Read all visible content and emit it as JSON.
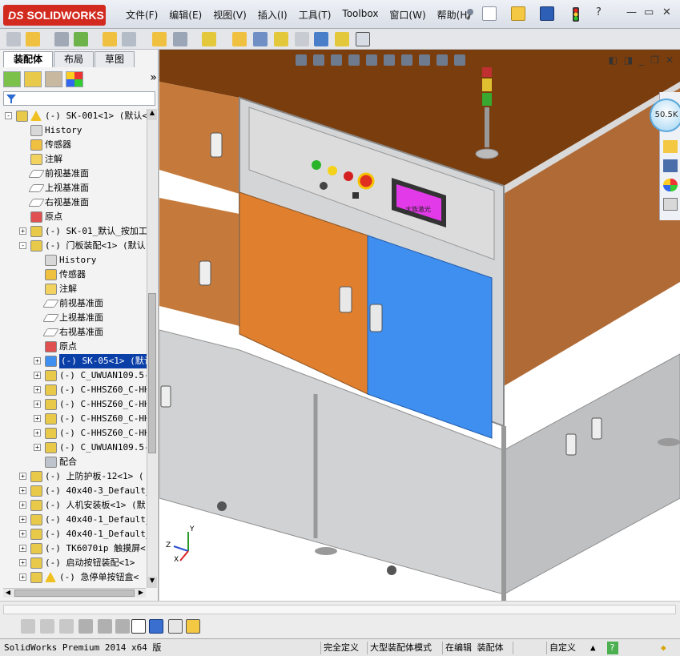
{
  "app": {
    "logo_text": "SOLIDWORKS",
    "logo_prefix": "DS"
  },
  "menu": [
    "文件(F)",
    "编辑(E)",
    "视图(V)",
    "插入(I)",
    "工具(T)",
    "Toolbox",
    "窗口(W)",
    "帮助(H)"
  ],
  "window_controls": {
    "help": "?",
    "minimize": "—",
    "restore": "▭",
    "close": "✕"
  },
  "tabs": [
    "装配体",
    "布局",
    "草图"
  ],
  "tree": [
    {
      "indent": 0,
      "expander": "-",
      "icon": "assembly",
      "warning": true,
      "label": "(-) SK-001<1> (默认<显"
    },
    {
      "indent": 1,
      "icon": "history",
      "label": "History"
    },
    {
      "indent": 1,
      "icon": "sensor",
      "label": "传感器"
    },
    {
      "indent": 1,
      "icon": "annotation",
      "label": "注解"
    },
    {
      "indent": 1,
      "icon": "plane",
      "label": "前视基准面"
    },
    {
      "indent": 1,
      "icon": "plane",
      "label": "上视基准面"
    },
    {
      "indent": 1,
      "icon": "plane",
      "label": "右视基准面"
    },
    {
      "indent": 1,
      "icon": "origin",
      "label": "原点"
    },
    {
      "indent": 1,
      "expander": "+",
      "icon": "part",
      "label": "(-) SK-01_默认_按加工"
    },
    {
      "indent": 1,
      "expander": "-",
      "icon": "assembly",
      "label": "(-) 门板装配<1> (默认"
    },
    {
      "indent": 2,
      "icon": "history",
      "label": "History"
    },
    {
      "indent": 2,
      "icon": "sensor",
      "label": "传感器"
    },
    {
      "indent": 2,
      "icon": "annotation",
      "label": "注解"
    },
    {
      "indent": 2,
      "icon": "plane",
      "label": "前视基准面"
    },
    {
      "indent": 2,
      "icon": "plane",
      "label": "上视基准面"
    },
    {
      "indent": 2,
      "icon": "plane",
      "label": "右视基准面"
    },
    {
      "indent": 2,
      "icon": "origin",
      "label": "原点"
    },
    {
      "indent": 2,
      "expander": "+",
      "icon": "part-blue",
      "selected": true,
      "label": "(-) SK-05<1> (默认"
    },
    {
      "indent": 2,
      "expander": "+",
      "icon": "part",
      "label": "(-) C_UWUAN109.5-"
    },
    {
      "indent": 2,
      "expander": "+",
      "icon": "part",
      "label": "(-) C-HHSZ60_C-HH"
    },
    {
      "indent": 2,
      "expander": "+",
      "icon": "part",
      "label": "(-) C-HHSZ60_C-HH"
    },
    {
      "indent": 2,
      "expander": "+",
      "icon": "part",
      "label": "(-) C-HHSZ60_C-HH"
    },
    {
      "indent": 2,
      "expander": "+",
      "icon": "part",
      "label": "(-) C-HHSZ60_C-HH"
    },
    {
      "indent": 2,
      "expander": "+",
      "icon": "part",
      "label": "(-) C_UWUAN109.5-"
    },
    {
      "indent": 2,
      "icon": "mate",
      "label": "配合"
    },
    {
      "indent": 1,
      "expander": "+",
      "icon": "part",
      "label": "(-) 上防护板-12<1> ("
    },
    {
      "indent": 1,
      "expander": "+",
      "icon": "part",
      "label": "(-) 40x40-3_Default_"
    },
    {
      "indent": 1,
      "expander": "+",
      "icon": "part",
      "label": "(-) 人机安装板<1> (默"
    },
    {
      "indent": 1,
      "expander": "+",
      "icon": "part",
      "label": "(-) 40x40-1_Default_"
    },
    {
      "indent": 1,
      "expander": "+",
      "icon": "part",
      "label": "(-) 40x40-1_Default_"
    },
    {
      "indent": 1,
      "expander": "+",
      "icon": "part",
      "label": "(-) TK6070ip 触摸屏<"
    },
    {
      "indent": 1,
      "expander": "+",
      "icon": "part",
      "label": "(-) 启动按钮装配<1>"
    },
    {
      "indent": 1,
      "expander": "+",
      "icon": "part",
      "warning": true,
      "label": "(-) 急停单按钮盒<"
    }
  ],
  "viewport": {
    "hmi_screen_text": "大族激光",
    "triad_labels": {
      "x": "X",
      "y": "Y",
      "z": "Z"
    }
  },
  "taskpane": {
    "bubble_text": "50.5K"
  },
  "status": {
    "product": "SolidWorks Premium 2014 x64 版",
    "fully_defined": "完全定义",
    "large_assembly": "大型装配体模式",
    "editing": "在编辑 装配体",
    "custom": "自定义"
  },
  "colors": {
    "logo_red": "#d22a1f",
    "floor_brown": "#7a3d0e",
    "orange_door": "#e07f2e",
    "blue_door": "#3f8ff0",
    "side_panel": "#c57a3c",
    "frame_gray": "#c9cacc",
    "hmi_pink": "#e23ae8"
  }
}
